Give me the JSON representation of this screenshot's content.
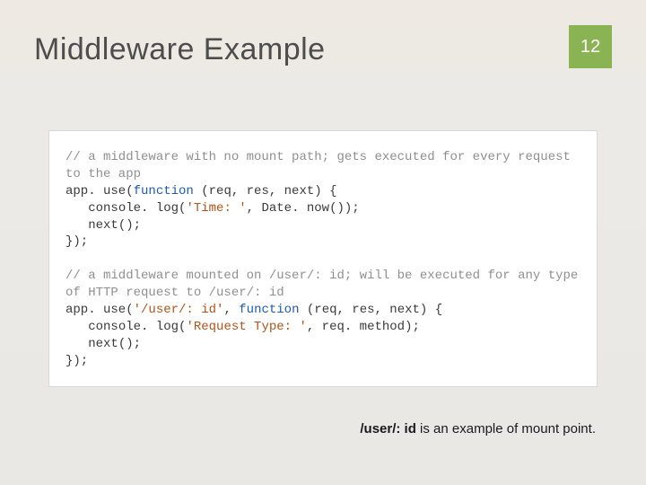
{
  "title": "Middleware Example",
  "page_number": "12",
  "code": {
    "comment1": "// a middleware with no mount path; gets executed for every request to the app",
    "l1a": "app. use(",
    "kw_function1": "function",
    "l1b": " (req, res, next) {",
    "l2a": "   console. log(",
    "str_time": "'Time: '",
    "l2b": ", Date. now());",
    "l3": "   next();",
    "l4": "});",
    "comment2": "// a middleware mounted on /user/: id; will be executed for any type of HTTP request to /user/: id",
    "l5a": "app. use(",
    "str_path": "'/user/: id'",
    "l5b": ", ",
    "kw_function2": "function",
    "l5c": " (req, res, next) {",
    "l6a": "   console. log(",
    "str_reqtype": "'Request Type: '",
    "l6b": ", req. method);",
    "l7": "   next();",
    "l8": "});"
  },
  "footnote": {
    "mount": "/user/: id",
    "rest": " is an example of mount point."
  }
}
